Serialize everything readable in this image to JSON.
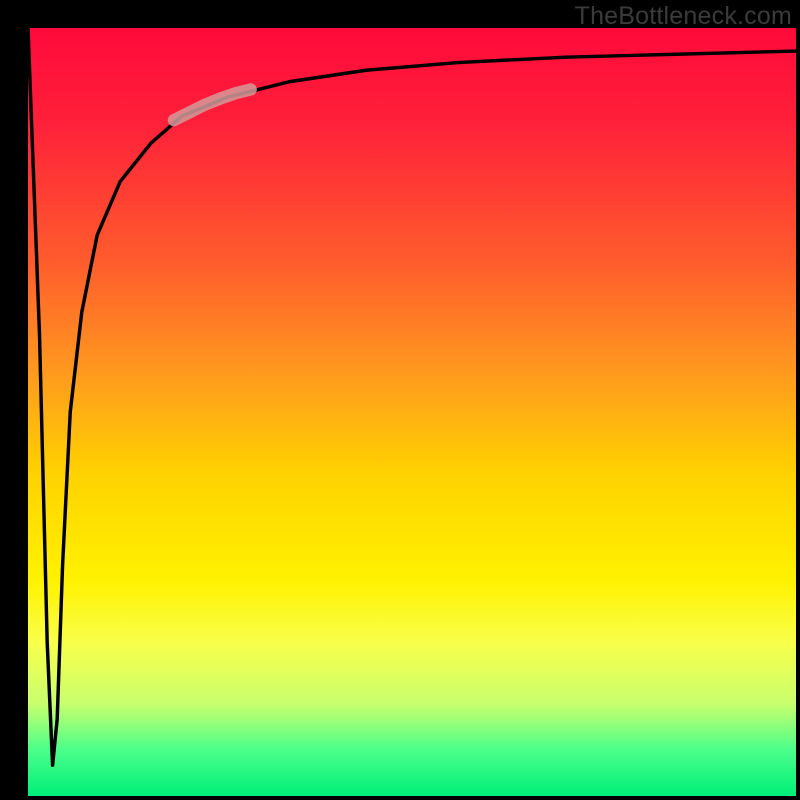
{
  "watermark": "TheBottleneck.com",
  "chart_data": {
    "type": "line",
    "title": "",
    "xlabel": "",
    "ylabel": "",
    "xlim": [
      0,
      100
    ],
    "ylim": [
      0,
      100
    ],
    "grid": false,
    "series": [
      {
        "name": "bottleneck-curve",
        "x": [
          0,
          1.5,
          2.5,
          3.2,
          3.8,
          4.5,
          5.5,
          7,
          9,
          12,
          16,
          20,
          26,
          34,
          44,
          56,
          70,
          85,
          100
        ],
        "y": [
          100,
          60,
          20,
          4,
          10,
          30,
          50,
          63,
          73,
          80,
          85,
          88.5,
          91,
          93,
          94.5,
          95.5,
          96.2,
          96.6,
          97
        ]
      },
      {
        "name": "highlight-segment",
        "x": [
          19,
          21,
          23,
          25,
          27,
          29
        ],
        "y": [
          88,
          89,
          90,
          90.8,
          91.5,
          92
        ]
      }
    ],
    "colors": {
      "curve": "#000000",
      "highlight": "#d39a9a",
      "gradient_top": "#ff0a3a",
      "gradient_bottom": "#00ef78",
      "frame": "#000000"
    },
    "legend": false
  }
}
